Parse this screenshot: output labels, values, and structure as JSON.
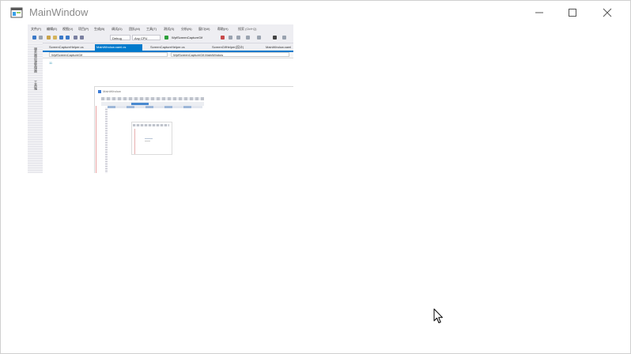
{
  "window": {
    "title": "MainWindow"
  },
  "capture": {
    "menu": [
      "文件(F)",
      "编辑(E)",
      "视图(V)",
      "项目(P)",
      "生成(B)",
      "调试(D)",
      "团队(M)",
      "工具(T)",
      "测试(S)",
      "分析(N)",
      "窗口(W)",
      "帮助(H)"
    ],
    "search": "搜索 (Ctrl+Q)",
    "toolbar": {
      "config": "Debug",
      "platform": "Any CPU",
      "start": "WpfScreenCaptureGif"
    },
    "side_labels": [
      "服务器资源管理器",
      "工具箱"
    ],
    "tabs": [
      "ScreenCaptureHelper.cs",
      "MainWindow.xaml.cs",
      "ScreenCaptureHelper.cs",
      "ScreenGifHelper(设计)",
      "MainWindow.xaml"
    ],
    "nav": {
      "left": "WpfScreenCaptureGif",
      "right": "WpfScreenCaptureGif.MainWindow"
    },
    "line_number": "11",
    "nested": {
      "title": "MainWindow"
    }
  },
  "colors": {
    "accent": "#007acc",
    "chrome": "#eeeef2"
  },
  "icons": [
    "app-window-icon",
    "minimize-icon",
    "maximize-icon",
    "close-icon",
    "mouse-pointer-icon"
  ]
}
